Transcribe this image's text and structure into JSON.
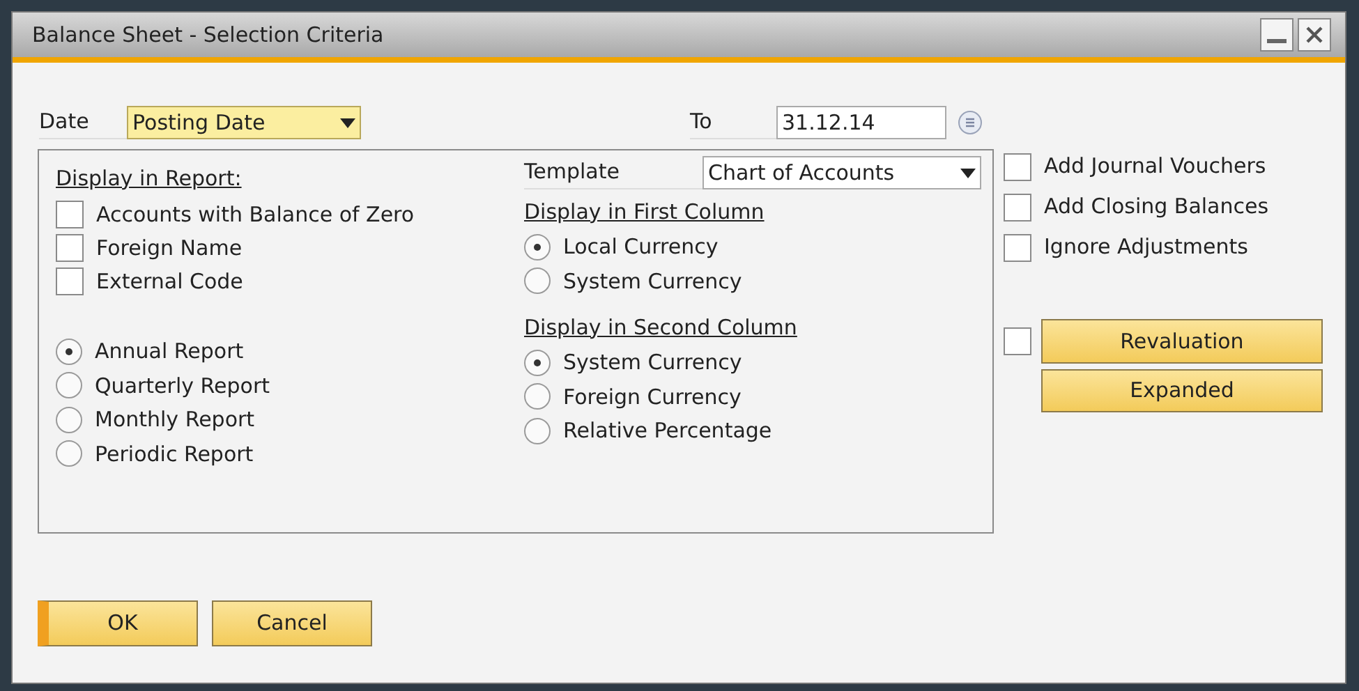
{
  "window": {
    "title": "Balance Sheet - Selection Criteria"
  },
  "date": {
    "label": "Date",
    "value": "Posting Date",
    "to_label": "To",
    "to_value": "31.12.14"
  },
  "display_in_report": {
    "heading": "Display in Report:",
    "checkboxes": [
      {
        "label": "Accounts with Balance of Zero",
        "checked": false
      },
      {
        "label": "Foreign Name",
        "checked": false
      },
      {
        "label": "External Code",
        "checked": false
      }
    ],
    "report_types": [
      {
        "label": "Annual Report",
        "selected": true
      },
      {
        "label": "Quarterly Report",
        "selected": false
      },
      {
        "label": "Monthly Report",
        "selected": false
      },
      {
        "label": "Periodic Report",
        "selected": false
      }
    ]
  },
  "template": {
    "label": "Template",
    "value": "Chart of Accounts"
  },
  "first_column": {
    "heading": "Display in First Column",
    "options": [
      {
        "label": "Local Currency",
        "selected": true
      },
      {
        "label": "System Currency",
        "selected": false
      }
    ]
  },
  "second_column": {
    "heading": "Display in Second Column",
    "options": [
      {
        "label": "System Currency",
        "selected": true
      },
      {
        "label": "Foreign Currency",
        "selected": false
      },
      {
        "label": "Relative Percentage",
        "selected": false
      }
    ]
  },
  "options": [
    {
      "label": "Add Journal Vouchers",
      "checked": false
    },
    {
      "label": "Add Closing Balances",
      "checked": false
    },
    {
      "label": "Ignore Adjustments",
      "checked": false
    }
  ],
  "revaluation": {
    "label": "Revaluation",
    "checked": false
  },
  "expanded": {
    "label": "Expanded"
  },
  "buttons": [
    {
      "label": "OK",
      "focused": true
    },
    {
      "label": "Cancel",
      "focused": false
    }
  ]
}
